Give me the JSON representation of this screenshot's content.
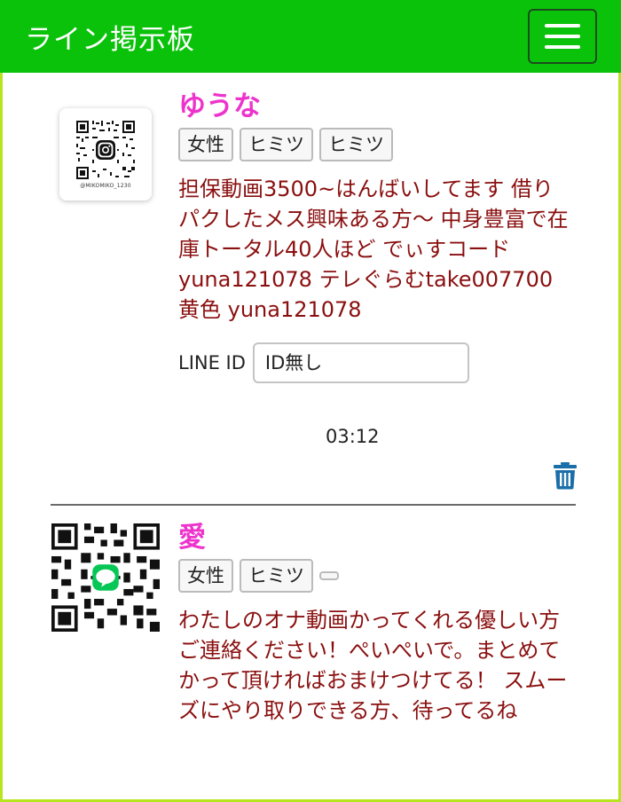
{
  "header": {
    "title": "ライン掲示板",
    "menu_icon": "hamburger-menu-icon",
    "background": "#0bc20b"
  },
  "posts": [
    {
      "name": "ゆうな",
      "qr_caption": "@MIKOMIKO_1230",
      "tags": [
        "女性",
        "ヒミツ",
        "ヒミツ"
      ],
      "message": "担保動画3500~はんばいしてます 借りパクしたメス興味ある方〜 中身豊富で在庫トータル40人ほど でぃすコードyuna121078 テレぐらむtake007700 黄色 yuna121078",
      "line_id_label": "LINE ID",
      "line_id_value": "ID無し",
      "time": "03:12"
    },
    {
      "name": "愛",
      "tags": [
        "女性",
        "ヒミツ",
        ""
      ],
      "message": "わたしのオナ動画かってくれる優しい方ご連絡ください！ぺいぺいで。まとめてかって頂ければおまけつけてる！ スムーズにやり取りできる方、待ってるね"
    }
  ],
  "colors": {
    "name": "#ee33cc",
    "message": "#8a0f0f",
    "border": "#b7e51d",
    "trash": "#1a6fa8"
  }
}
